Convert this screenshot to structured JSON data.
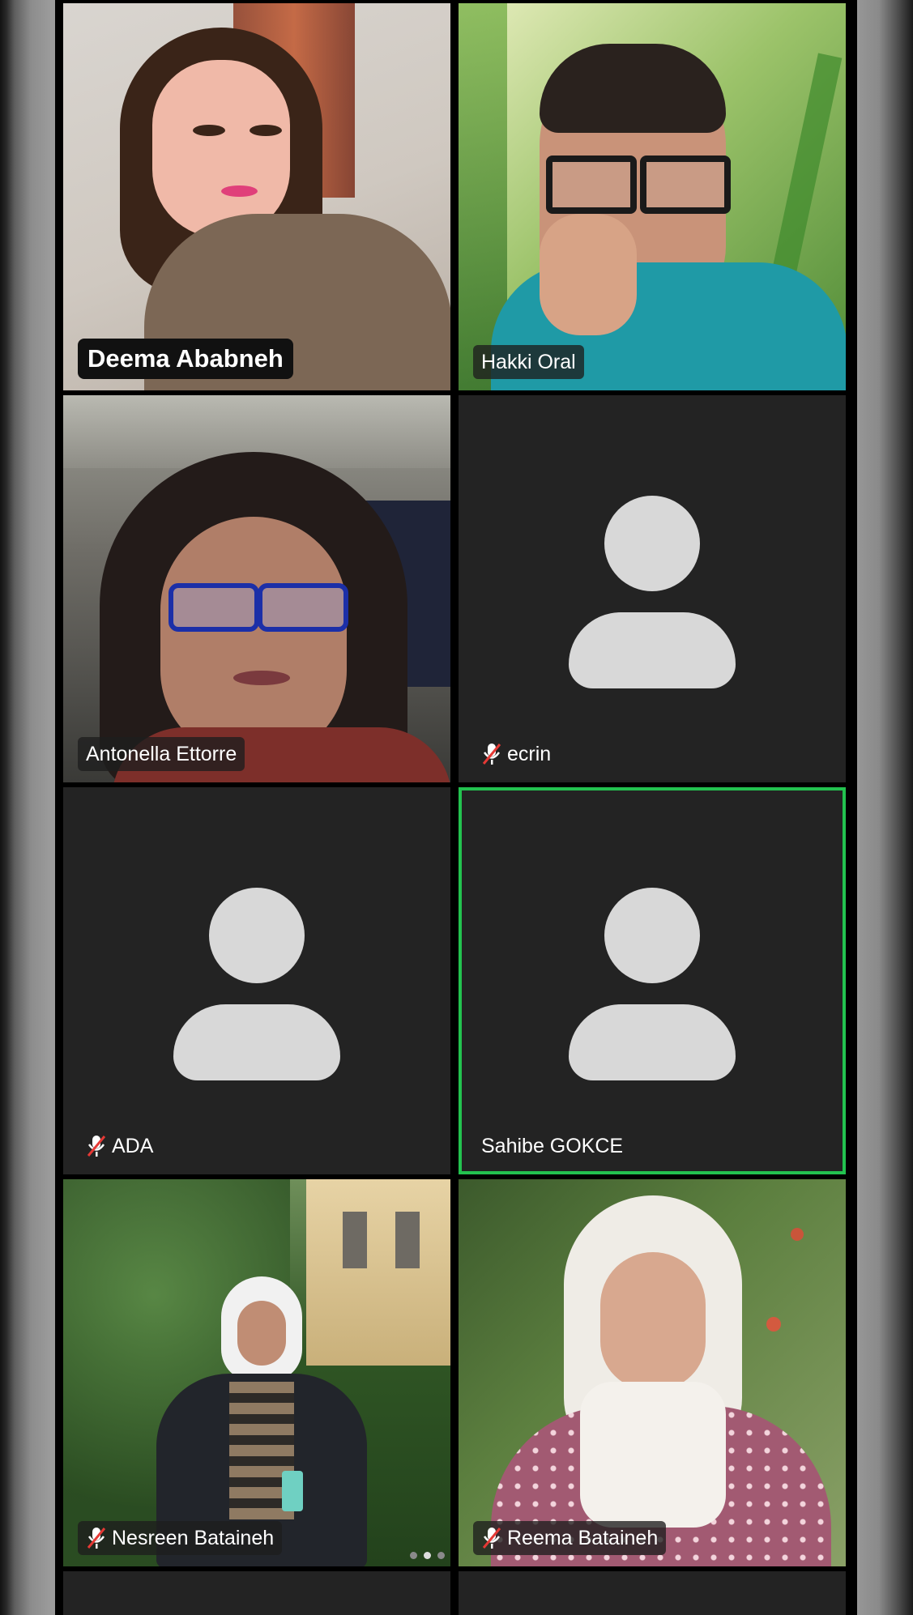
{
  "participants": [
    {
      "name": "Deema Ababneh",
      "muted": false,
      "video": true
    },
    {
      "name": "Hakki Oral",
      "muted": false,
      "video": true
    },
    {
      "name": "Antonella Ettorre",
      "muted": false,
      "video": true
    },
    {
      "name": "ecrin",
      "muted": true,
      "video": false
    },
    {
      "name": "ADA",
      "muted": true,
      "video": false
    },
    {
      "name": "Sahibe GOKCE",
      "muted": false,
      "video": false,
      "active_speaker": true
    },
    {
      "name": "Nesreen Bataineh",
      "muted": true,
      "video": true
    },
    {
      "name": "Reema Bataineh",
      "muted": true,
      "video": true
    }
  ],
  "icons": {
    "muted": "mic-off-icon",
    "no_video": "avatar-icon"
  },
  "colors": {
    "active_speaker_border": "#23c24f",
    "tile_background": "#232323",
    "avatar": "#d8d8d8"
  }
}
